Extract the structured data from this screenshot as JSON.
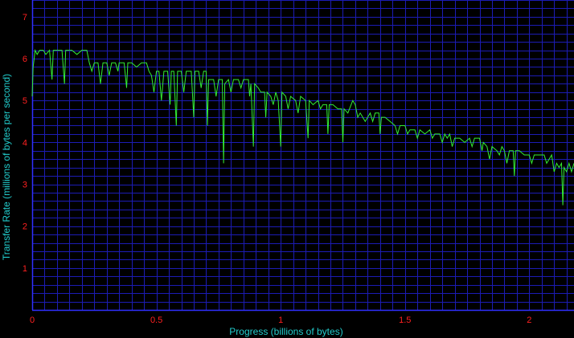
{
  "chart_data": {
    "type": "line",
    "title": "",
    "xlabel": "Progress (billions of bytes)",
    "ylabel": "Transfer Rate (millions of bytes per second)",
    "xlim": [
      0,
      2.18
    ],
    "ylim": [
      0,
      7.4
    ],
    "x_ticks": [
      {
        "value": 0,
        "label": "0"
      },
      {
        "value": 0.5,
        "label": "0.5"
      },
      {
        "value": 1,
        "label": "1"
      },
      {
        "value": 1.5,
        "label": "1.5"
      },
      {
        "value": 2,
        "label": "2"
      }
    ],
    "y_ticks": [
      {
        "value": 1,
        "label": "1"
      },
      {
        "value": 2,
        "label": "2"
      },
      {
        "value": 3,
        "label": "3"
      },
      {
        "value": 4,
        "label": "4"
      },
      {
        "value": 5,
        "label": "5"
      },
      {
        "value": 6,
        "label": "6"
      },
      {
        "value": 7,
        "label": "7"
      }
    ],
    "x_minor_step": 0.05,
    "y_minor_step": 0.2,
    "grid": true,
    "legend": "none",
    "colors": {
      "background": "#000000",
      "grid": "#1c1cb4",
      "axis": "#3030ff",
      "line": "#33ee33",
      "tick_label": "#ff2020",
      "axis_title": "#22cccc"
    },
    "series": [
      {
        "values": [
          [
            0.0,
            5.1
          ],
          [
            0.004,
            5.8
          ],
          [
            0.008,
            6.0
          ],
          [
            0.012,
            6.2
          ],
          [
            0.02,
            6.1
          ],
          [
            0.03,
            6.2
          ],
          [
            0.045,
            6.2
          ],
          [
            0.055,
            6.1
          ],
          [
            0.07,
            6.2
          ],
          [
            0.08,
            5.5
          ],
          [
            0.085,
            6.2
          ],
          [
            0.1,
            6.2
          ],
          [
            0.12,
            6.2
          ],
          [
            0.13,
            5.4
          ],
          [
            0.135,
            6.2
          ],
          [
            0.16,
            6.2
          ],
          [
            0.18,
            6.1
          ],
          [
            0.2,
            6.2
          ],
          [
            0.22,
            6.2
          ],
          [
            0.23,
            5.9
          ],
          [
            0.24,
            5.7
          ],
          [
            0.25,
            5.9
          ],
          [
            0.265,
            5.9
          ],
          [
            0.275,
            5.4
          ],
          [
            0.285,
            5.9
          ],
          [
            0.3,
            5.9
          ],
          [
            0.31,
            5.6
          ],
          [
            0.32,
            5.9
          ],
          [
            0.335,
            5.9
          ],
          [
            0.345,
            5.7
          ],
          [
            0.35,
            5.9
          ],
          [
            0.37,
            5.9
          ],
          [
            0.38,
            5.3
          ],
          [
            0.385,
            5.9
          ],
          [
            0.4,
            5.9
          ],
          [
            0.42,
            5.8
          ],
          [
            0.44,
            5.9
          ],
          [
            0.46,
            5.9
          ],
          [
            0.47,
            5.7
          ],
          [
            0.48,
            5.6
          ],
          [
            0.49,
            5.2
          ],
          [
            0.5,
            5.7
          ],
          [
            0.51,
            5.7
          ],
          [
            0.52,
            5.0
          ],
          [
            0.53,
            5.7
          ],
          [
            0.545,
            5.7
          ],
          [
            0.555,
            4.9
          ],
          [
            0.56,
            5.7
          ],
          [
            0.57,
            5.7
          ],
          [
            0.58,
            4.4
          ],
          [
            0.585,
            5.7
          ],
          [
            0.6,
            5.7
          ],
          [
            0.61,
            5.2
          ],
          [
            0.62,
            5.7
          ],
          [
            0.64,
            5.7
          ],
          [
            0.65,
            4.6
          ],
          [
            0.655,
            5.7
          ],
          [
            0.67,
            5.7
          ],
          [
            0.68,
            5.3
          ],
          [
            0.69,
            5.7
          ],
          [
            0.7,
            5.7
          ],
          [
            0.705,
            4.4
          ],
          [
            0.71,
            5.5
          ],
          [
            0.73,
            5.5
          ],
          [
            0.74,
            5.1
          ],
          [
            0.75,
            5.5
          ],
          [
            0.765,
            5.5
          ],
          [
            0.77,
            3.5
          ],
          [
            0.775,
            5.4
          ],
          [
            0.79,
            5.5
          ],
          [
            0.8,
            5.2
          ],
          [
            0.81,
            5.5
          ],
          [
            0.83,
            5.5
          ],
          [
            0.84,
            5.3
          ],
          [
            0.85,
            5.5
          ],
          [
            0.87,
            5.5
          ],
          [
            0.875,
            5.1
          ],
          [
            0.88,
            5.4
          ],
          [
            0.89,
            3.9
          ],
          [
            0.895,
            5.4
          ],
          [
            0.91,
            5.3
          ],
          [
            0.92,
            5.2
          ],
          [
            0.935,
            5.2
          ],
          [
            0.94,
            4.6
          ],
          [
            0.945,
            5.2
          ],
          [
            0.96,
            5.1
          ],
          [
            0.97,
            4.9
          ],
          [
            0.98,
            5.2
          ],
          [
            0.99,
            5.0
          ],
          [
            1.0,
            3.9
          ],
          [
            1.005,
            5.2
          ],
          [
            1.02,
            5.1
          ],
          [
            1.03,
            4.8
          ],
          [
            1.04,
            5.1
          ],
          [
            1.06,
            5.0
          ],
          [
            1.07,
            4.7
          ],
          [
            1.08,
            5.1
          ],
          [
            1.1,
            5.0
          ],
          [
            1.11,
            4.1
          ],
          [
            1.115,
            5.0
          ],
          [
            1.13,
            4.9
          ],
          [
            1.15,
            5.0
          ],
          [
            1.16,
            4.8
          ],
          [
            1.17,
            4.9
          ],
          [
            1.185,
            4.9
          ],
          [
            1.19,
            4.2
          ],
          [
            1.195,
            4.9
          ],
          [
            1.21,
            4.9
          ],
          [
            1.23,
            4.8
          ],
          [
            1.245,
            4.8
          ],
          [
            1.25,
            4.0
          ],
          [
            1.255,
            4.8
          ],
          [
            1.27,
            4.7
          ],
          [
            1.29,
            5.0
          ],
          [
            1.3,
            4.9
          ],
          [
            1.31,
            4.6
          ],
          [
            1.32,
            4.7
          ],
          [
            1.34,
            4.5
          ],
          [
            1.36,
            4.7
          ],
          [
            1.37,
            4.5
          ],
          [
            1.38,
            4.7
          ],
          [
            1.395,
            4.7
          ],
          [
            1.4,
            4.2
          ],
          [
            1.405,
            4.6
          ],
          [
            1.42,
            4.6
          ],
          [
            1.44,
            4.5
          ],
          [
            1.46,
            4.4
          ],
          [
            1.47,
            4.2
          ],
          [
            1.48,
            4.4
          ],
          [
            1.5,
            4.4
          ],
          [
            1.51,
            4.2
          ],
          [
            1.52,
            4.3
          ],
          [
            1.54,
            4.3
          ],
          [
            1.55,
            4.1
          ],
          [
            1.56,
            4.3
          ],
          [
            1.58,
            4.2
          ],
          [
            1.6,
            4.3
          ],
          [
            1.61,
            4.1
          ],
          [
            1.62,
            4.2
          ],
          [
            1.64,
            4.2
          ],
          [
            1.65,
            4.0
          ],
          [
            1.66,
            4.2
          ],
          [
            1.67,
            4.1
          ],
          [
            1.68,
            4.2
          ],
          [
            1.69,
            3.9
          ],
          [
            1.7,
            4.1
          ],
          [
            1.72,
            4.1
          ],
          [
            1.74,
            4.0
          ],
          [
            1.76,
            4.1
          ],
          [
            1.77,
            3.9
          ],
          [
            1.78,
            4.1
          ],
          [
            1.8,
            4.1
          ],
          [
            1.81,
            3.8
          ],
          [
            1.815,
            4.0
          ],
          [
            1.83,
            3.9
          ],
          [
            1.84,
            3.6
          ],
          [
            1.85,
            3.9
          ],
          [
            1.87,
            3.8
          ],
          [
            1.88,
            3.7
          ],
          [
            1.89,
            3.9
          ],
          [
            1.9,
            3.8
          ],
          [
            1.91,
            3.5
          ],
          [
            1.92,
            3.8
          ],
          [
            1.935,
            3.8
          ],
          [
            1.94,
            3.2
          ],
          [
            1.945,
            3.8
          ],
          [
            1.96,
            3.8
          ],
          [
            1.98,
            3.7
          ],
          [
            2.0,
            3.7
          ],
          [
            2.01,
            3.5
          ],
          [
            2.02,
            3.7
          ],
          [
            2.04,
            3.7
          ],
          [
            2.06,
            3.7
          ],
          [
            2.07,
            3.5
          ],
          [
            2.08,
            3.6
          ],
          [
            2.09,
            3.7
          ],
          [
            2.1,
            3.3
          ],
          [
            2.11,
            3.5
          ],
          [
            2.12,
            3.4
          ],
          [
            2.13,
            3.5
          ],
          [
            2.135,
            2.5
          ],
          [
            2.14,
            3.4
          ],
          [
            2.15,
            3.3
          ],
          [
            2.16,
            3.5
          ],
          [
            2.17,
            3.3
          ],
          [
            2.18,
            3.5
          ]
        ]
      }
    ]
  }
}
